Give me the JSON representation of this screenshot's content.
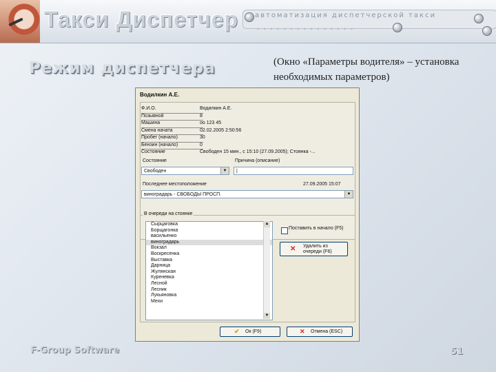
{
  "header": {
    "brand_title": "Такси Диспетчер",
    "tagline": "автоматизация диспетчерской такси"
  },
  "slide": {
    "heading": "Режим диспетчера",
    "caption": "(Окно «Параметры водителя» – установка необходимых параметров)",
    "footer_left": "F-Group Software",
    "page_number": "51"
  },
  "dialog": {
    "title": "Водилкин А.Е.",
    "info_rows": [
      {
        "label": "Ф.И.О.",
        "value": "Водилкин А.Е."
      },
      {
        "label": "Позывной",
        "value": "8"
      },
      {
        "label": "Машина",
        "value": "оо 123 45"
      },
      {
        "label": "Смена начата",
        "value": "02.02.2005 2:50:56"
      },
      {
        "label": "Пробег (начало)",
        "value": "30"
      },
      {
        "label": "Бензин (начало)",
        "value": "0"
      },
      {
        "label": "Состояние",
        "value": "Свободен 15 мин., с 15:10 (27.09.2005); Стоянка -..."
      }
    ],
    "state_label": "Состояние",
    "state_value": "Свободен",
    "reason_label": "Причина (описание)",
    "reason_value": "|",
    "last_location_label": "Последнее местоположение",
    "last_location_time": "27.09.2005 15:07",
    "last_location_value": "виноградарь - СВОБОДЫ ПРОСП.",
    "queue_legend": "В очереди на стоянке",
    "stops": [
      "Сырцаговка",
      "Борщагонка",
      "васильенко",
      "виноградарь",
      "Вокзал",
      "Воскресенка",
      "Выставка",
      "Дарница",
      "Жулянская",
      "Куреневка",
      "Лесной",
      "Лесник",
      "Лукьяновка",
      "Мехи"
    ],
    "selected_stop_index": 3,
    "put_first_label": "Поставить в начало (F5)",
    "remove_label": "Удалить из очереди (F6)",
    "ok_label": "Ок (F9)",
    "cancel_label": "Отмена (ESC)"
  },
  "colors": {
    "dialog_bg": "#ece9d8",
    "input_border": "#7f9db9",
    "button_border": "#003c74",
    "remove_icon": "#dd2222",
    "ok_icon": "#d6a200"
  },
  "icons": [
    "globe-icon",
    "dropdown-arrow-icon",
    "x-icon",
    "check-icon"
  ]
}
